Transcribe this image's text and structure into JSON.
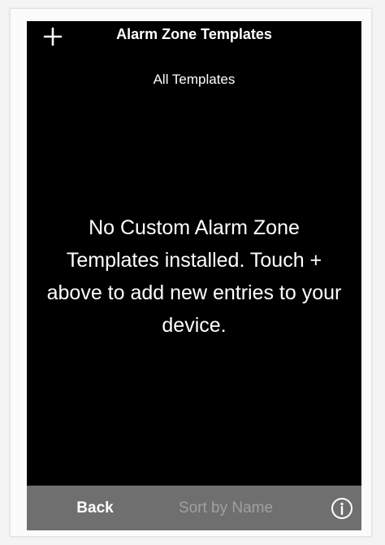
{
  "navbar": {
    "title": "Alarm Zone Templates",
    "add_icon": "plus-icon"
  },
  "subtitle": "All Templates",
  "empty_message": "No Custom Alarm Zone Templates installed. Touch + above to add new entries to your device.",
  "toolbar": {
    "back_label": "Back",
    "sort_label": "Sort by Name",
    "info_icon": "info-icon"
  },
  "colors": {
    "screen_bg": "#000000",
    "toolbar_bg": "#6f6f6f",
    "text": "#ffffff",
    "disabled_text": "#a0a0a0"
  }
}
